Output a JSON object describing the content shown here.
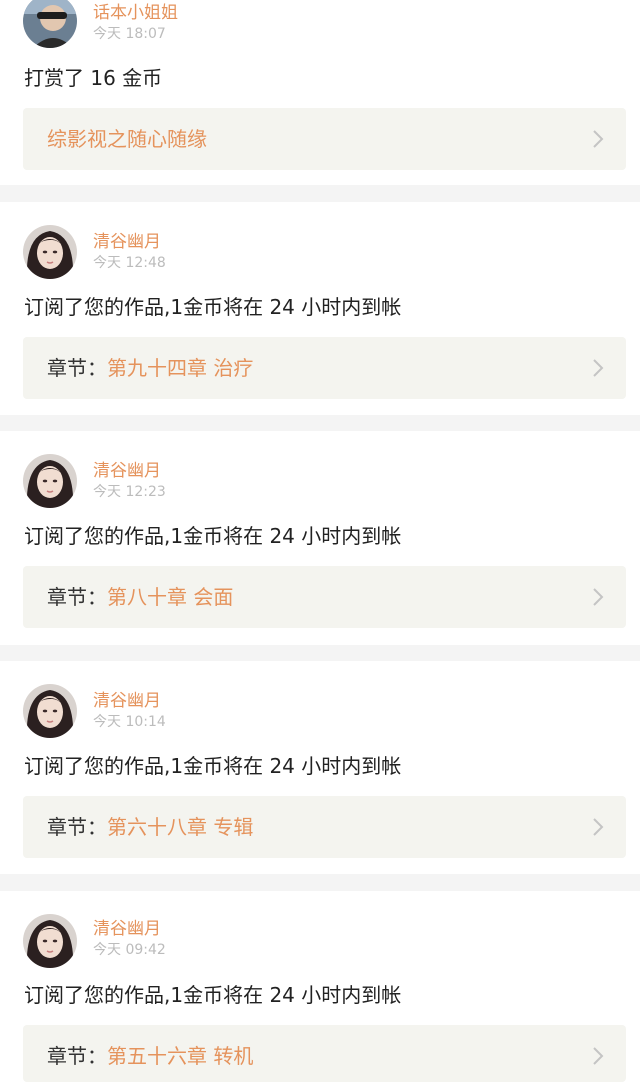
{
  "theme": {
    "accent": "#e5935c",
    "text": "#222222",
    "muted": "#bcbcbc",
    "link_box_bg": "#f4f4ef",
    "page_bg": "#f4f4f4"
  },
  "notifications": [
    {
      "user": "话本小姐姐",
      "time": "今天 18:07",
      "message": "打赏了 16 金币",
      "link_prefix": "",
      "link_title": "综影视之随心随缘",
      "icon": "chevron-right-icon"
    },
    {
      "user": "清谷幽月",
      "time": "今天 12:48",
      "message": "订阅了您的作品,1金币将在 24 小时内到帐",
      "link_prefix": "章节：",
      "link_title": "第九十四章 治疗",
      "icon": "chevron-right-icon"
    },
    {
      "user": "清谷幽月",
      "time": "今天 12:23",
      "message": "订阅了您的作品,1金币将在 24 小时内到帐",
      "link_prefix": "章节：",
      "link_title": "第八十章 会面",
      "icon": "chevron-right-icon"
    },
    {
      "user": "清谷幽月",
      "time": "今天 10:14",
      "message": "订阅了您的作品,1金币将在 24 小时内到帐",
      "link_prefix": "章节：",
      "link_title": "第六十八章 专辑",
      "icon": "chevron-right-icon"
    },
    {
      "user": "清谷幽月",
      "time": "今天 09:42",
      "message": "订阅了您的作品,1金币将在 24 小时内到帐",
      "link_prefix": "章节：",
      "link_title": "第五十六章 转机",
      "icon": "chevron-right-icon"
    }
  ]
}
